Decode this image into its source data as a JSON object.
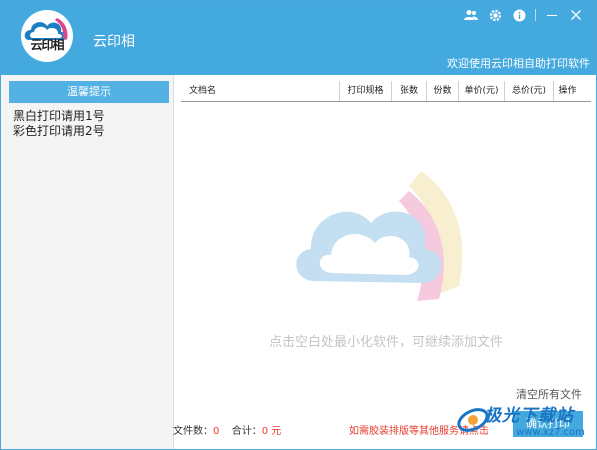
{
  "header": {
    "app_title": "云印相",
    "logo_text": "云印相",
    "welcome": "欢迎使用云印相自助打印软件"
  },
  "sidebar": {
    "tips_title": "温馨提示",
    "printers": [
      "黑白打印请用1号",
      "彩色打印请用2号"
    ]
  },
  "table": {
    "columns": [
      "文档名",
      "打印规格",
      "张数",
      "份数",
      "单价(元)",
      "总价(元)",
      "操作"
    ]
  },
  "main": {
    "hint": "点击空白处最小化软件，可继续添加文件",
    "clear_all": "清空所有文件"
  },
  "footer": {
    "file_count_label": "文件数：",
    "file_count": "0",
    "total_label": "合计：",
    "total_value": "0 元",
    "notice": "如需胶装排版等其他服务请点击",
    "confirm_button": "确认打印"
  },
  "watermark": {
    "site_name": "极光下载站",
    "site_url": "www.xz7.com"
  },
  "icons": {
    "user": "user-icon",
    "settings": "gear-icon",
    "info": "info-icon",
    "minimize": "minimize-icon",
    "close": "close-icon"
  },
  "colors": {
    "accent": "#44a9de",
    "alert": "#e53b2c"
  }
}
